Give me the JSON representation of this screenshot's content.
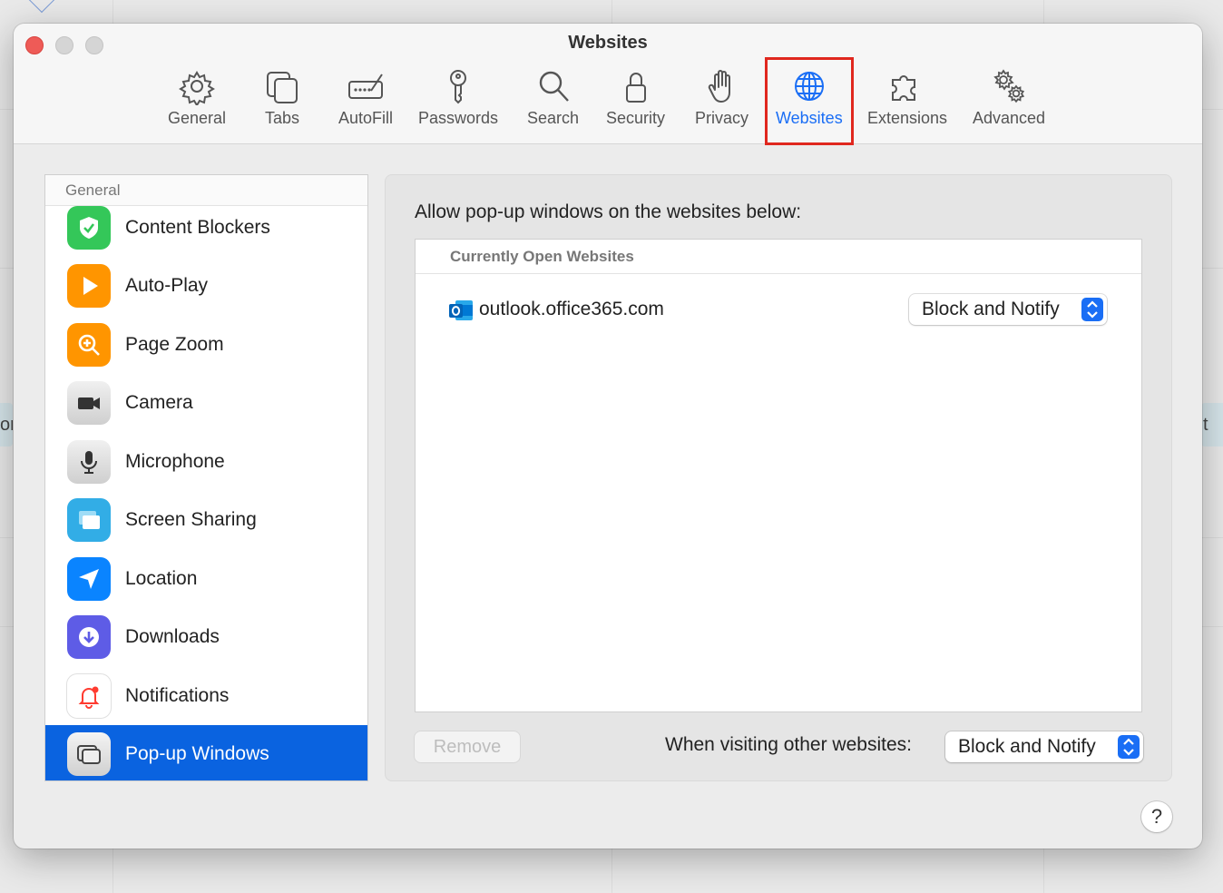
{
  "window": {
    "title": "Websites"
  },
  "toolbar": {
    "items": [
      {
        "label": "General",
        "icon": "gear-icon"
      },
      {
        "label": "Tabs",
        "icon": "tabs-icon"
      },
      {
        "label": "AutoFill",
        "icon": "autofill-icon"
      },
      {
        "label": "Passwords",
        "icon": "key-icon"
      },
      {
        "label": "Search",
        "icon": "search-icon"
      },
      {
        "label": "Security",
        "icon": "lock-icon"
      },
      {
        "label": "Privacy",
        "icon": "hand-icon"
      },
      {
        "label": "Websites",
        "icon": "globe-icon",
        "active": true
      },
      {
        "label": "Extensions",
        "icon": "puzzle-icon"
      },
      {
        "label": "Advanced",
        "icon": "gears-icon"
      }
    ],
    "active_color": "#1a6ef5",
    "highlight_color": "#e0271e"
  },
  "sidebar": {
    "header": "General",
    "items": [
      {
        "label": "Content Blockers",
        "icon": "shield-check-icon",
        "color": "#34c759"
      },
      {
        "label": "Auto-Play",
        "icon": "play-icon",
        "color": "#ff9500"
      },
      {
        "label": "Page Zoom",
        "icon": "zoom-icon",
        "color": "#ff9500"
      },
      {
        "label": "Camera",
        "icon": "camera-icon",
        "color": "#8e8e93"
      },
      {
        "label": "Microphone",
        "icon": "microphone-icon",
        "color": "#8e8e93"
      },
      {
        "label": "Screen Sharing",
        "icon": "screen-sharing-icon",
        "color": "#32ade6"
      },
      {
        "label": "Location",
        "icon": "location-arrow-icon",
        "color": "#0a84ff"
      },
      {
        "label": "Downloads",
        "icon": "download-icon",
        "color": "#5e5ce6"
      },
      {
        "label": "Notifications",
        "icon": "bell-icon",
        "color": "#ffffff"
      },
      {
        "label": "Pop-up Windows",
        "icon": "popup-windows-icon",
        "color": "#8e8e93",
        "selected": true
      }
    ],
    "selected_color": "#0a63e0"
  },
  "main": {
    "heading": "Allow pop-up windows on the websites below:",
    "list_header": "Currently Open Websites",
    "sites": [
      {
        "name": "outlook.office365.com",
        "icon": "outlook-icon",
        "setting": "Block and Notify"
      }
    ],
    "remove_label": "Remove",
    "other_label": "When visiting other websites:",
    "other_setting": "Block and Notify"
  },
  "help_label": "?"
}
